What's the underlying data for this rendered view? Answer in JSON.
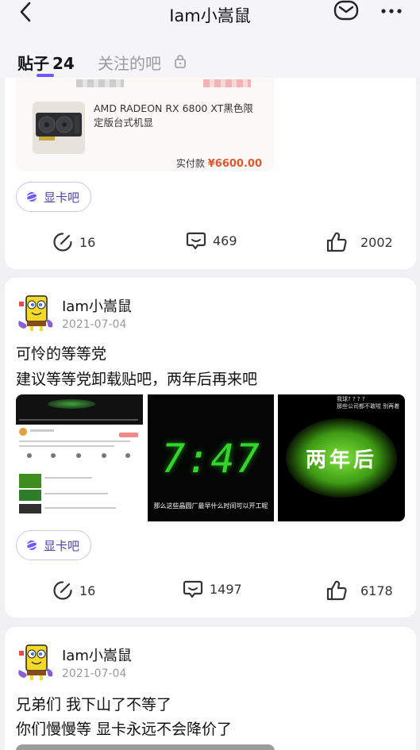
{
  "header": {
    "title": "Iam小嵩鼠",
    "tabs": [
      {
        "label": "贴子",
        "count": "24"
      },
      {
        "label": "关注的吧"
      }
    ]
  },
  "posts": [
    {
      "order": {
        "product": "AMD RADEON RX 6800 XT黑色限定版台式机显",
        "paid_label": "实付款",
        "amount": "¥6600.00"
      },
      "tag": "显卡吧",
      "stats": {
        "comments": "16",
        "views": "469",
        "likes": "2002"
      }
    },
    {
      "author": "Iam小嵩鼠",
      "date": "2021-07-04",
      "title": "可怜的等等党",
      "body": "建议等等党卸载贴吧，两年后再来吧",
      "images": {
        "clock": "7:47",
        "clock_caption": "那么这些晶圆厂最早什么时间可以开工呢",
        "big_text": "两年后",
        "top_text_1": "我球? ? ? ?",
        "top_text_2": "那些公司都不敢啦  别再着"
      },
      "tag": "显卡吧",
      "stats": {
        "comments": "16",
        "views": "1497",
        "likes": "6178"
      }
    },
    {
      "author": "Iam小嵩鼠",
      "date": "2021-07-04",
      "title": "兄弟们 我下山了不等了",
      "body": "你们慢慢等 显卡永远不会降价了"
    }
  ]
}
